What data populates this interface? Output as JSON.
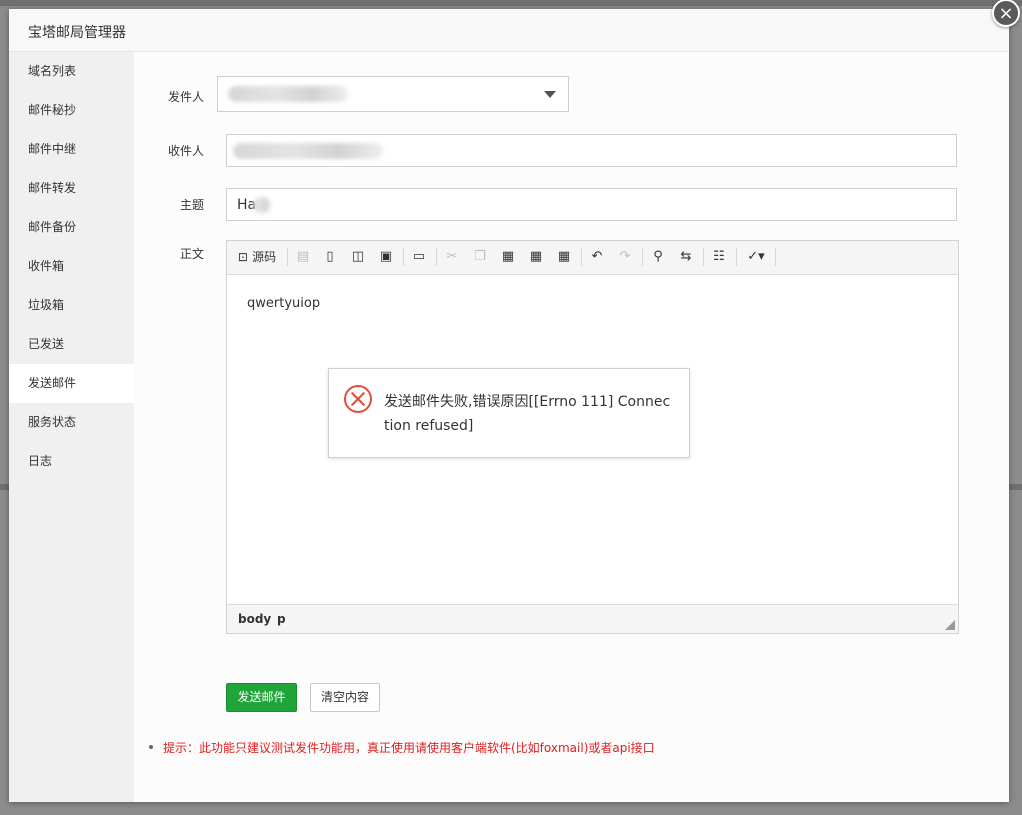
{
  "modal": {
    "title": "宝塔邮局管理器",
    "close": "×"
  },
  "sidebar": {
    "items": [
      {
        "label": "域名列表"
      },
      {
        "label": "邮件秘抄"
      },
      {
        "label": "邮件中继"
      },
      {
        "label": "邮件转发"
      },
      {
        "label": "邮件备份"
      },
      {
        "label": "收件箱"
      },
      {
        "label": "垃圾箱"
      },
      {
        "label": "已发送"
      },
      {
        "label": "发送邮件",
        "active": true
      },
      {
        "label": "服务状态"
      },
      {
        "label": "日志"
      }
    ]
  },
  "form": {
    "sender_label": "发件人",
    "recipient_label": "收件人",
    "subject_label": "主题",
    "subject_value": "Ha",
    "body_label": "正文"
  },
  "editor": {
    "source_label": "源码",
    "body_text": "qwertyuiop",
    "path": [
      "body",
      "p"
    ]
  },
  "alert": {
    "message": "发送邮件失败,错误原因[[Errno 111] Connection refused]",
    "status_color": "#e44b3b"
  },
  "actions": {
    "send_label": "发送邮件",
    "clear_label": "清空内容"
  },
  "tip": "提示：此功能只建议测试发件功能用，真正使用请使用客户端软件(比如foxmail)或者api接口",
  "colors": {
    "accent": "#20a53a",
    "tip": "#e02020"
  }
}
